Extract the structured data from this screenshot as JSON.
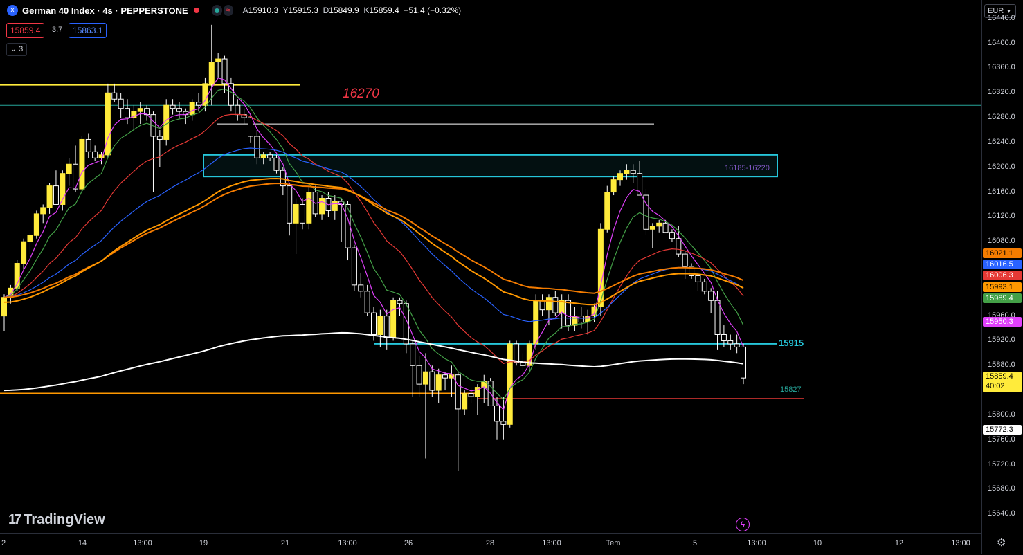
{
  "header": {
    "symbol_badge": "X",
    "title": "German 40 Index · 4s · PEPPERSTONE",
    "ohlc": [
      {
        "k": "A",
        "v": "15910.3"
      },
      {
        "k": "Y",
        "v": "15915.3"
      },
      {
        "k": "D",
        "v": "15849.9"
      },
      {
        "k": "K",
        "v": "15859.4"
      }
    ],
    "change": "−51.4 (−0.32%)",
    "sell_price": "15859.4",
    "spread": "3.7",
    "buy_price": "15863.1",
    "indicator_count": "3"
  },
  "currency": "EUR",
  "big_label": "16270",
  "zone_label": "16185-16220",
  "line_label_15915": "15915",
  "line_label_15827": "15827",
  "brand": "TradingView",
  "price_ticks": [
    "16440.0",
    "16400.0",
    "16360.0",
    "16320.0",
    "16280.0",
    "16240.0",
    "16200.0",
    "16160.0",
    "16120.0",
    "16080.0",
    "15960.0",
    "15920.0",
    "15880.0",
    "15800.0",
    "15760.0",
    "15720.0",
    "15680.0",
    "15640.0"
  ],
  "price_tags": [
    {
      "text": "16021.1",
      "bg": "#f57c00",
      "fg": "#000"
    },
    {
      "text": "16016.5",
      "bg": "#2962ff",
      "fg": "#fff"
    },
    {
      "text": "16006.3",
      "bg": "#e53935",
      "fg": "#fff"
    },
    {
      "text": "15993.1",
      "bg": "#ff9800",
      "fg": "#000"
    },
    {
      "text": "15989.4",
      "bg": "#43a047",
      "fg": "#fff"
    },
    {
      "text": "15950.3",
      "bg": "#e040fb",
      "fg": "#fff"
    },
    {
      "text": "15772.3",
      "bg": "#ffffff",
      "fg": "#000"
    }
  ],
  "current_price": {
    "price": "15859.4",
    "countdown": "40:02",
    "bg": "#ffeb3b"
  },
  "time_ticks": [
    "2",
    "14",
    "13:00",
    "19",
    "21",
    "13:00",
    "26",
    "28",
    "13:00",
    "Tem",
    "5",
    "13:00",
    "10",
    "12",
    "13:00"
  ],
  "chart_data": {
    "type": "candlestick",
    "symbol": "German 40 Index",
    "timeframe": "4s",
    "ylim": [
      15610,
      16470
    ],
    "candles": [
      [
        15960,
        15995,
        15935,
        15990
      ],
      [
        15990,
        16010,
        15980,
        16005
      ],
      [
        16005,
        16050,
        16000,
        16045
      ],
      [
        16045,
        16085,
        16035,
        16080
      ],
      [
        16080,
        16095,
        16060,
        16090
      ],
      [
        16090,
        16130,
        16085,
        16125
      ],
      [
        16125,
        16140,
        16110,
        16135
      ],
      [
        16135,
        16175,
        16125,
        16170
      ],
      [
        16170,
        16195,
        16150,
        16140
      ],
      [
        16140,
        16195,
        16130,
        16190
      ],
      [
        16190,
        16215,
        16170,
        16205
      ],
      [
        16205,
        16235,
        16160,
        16165
      ],
      [
        16165,
        16250,
        16160,
        16245
      ],
      [
        16245,
        16255,
        16215,
        16225
      ],
      [
        16225,
        16235,
        16210,
        16215
      ],
      [
        16215,
        16225,
        16205,
        16220
      ],
      [
        16220,
        16335,
        16215,
        16320
      ],
      [
        16320,
        16335,
        16305,
        16310
      ],
      [
        16310,
        16320,
        16280,
        16295
      ],
      [
        16295,
        16310,
        16270,
        16280
      ],
      [
        16280,
        16300,
        16260,
        16290
      ],
      [
        16290,
        16305,
        16270,
        16295
      ],
      [
        16295,
        16300,
        16275,
        16285
      ],
      [
        16285,
        16290,
        16160,
        16250
      ],
      [
        16250,
        16260,
        16200,
        16245
      ],
      [
        16245,
        16310,
        16235,
        16300
      ],
      [
        16300,
        16310,
        16285,
        16295
      ],
      [
        16295,
        16305,
        16280,
        16290
      ],
      [
        16290,
        16295,
        16270,
        16285
      ],
      [
        16285,
        16310,
        16275,
        16305
      ],
      [
        16305,
        16320,
        16290,
        16300
      ],
      [
        16300,
        16345,
        16290,
        16335
      ],
      [
        16335,
        16430,
        16300,
        16370
      ],
      [
        16370,
        16385,
        16345,
        16375
      ],
      [
        16375,
        16380,
        16320,
        16335
      ],
      [
        16335,
        16345,
        16290,
        16300
      ],
      [
        16300,
        16310,
        16275,
        16285
      ],
      [
        16285,
        16295,
        16270,
        16280
      ],
      [
        16280,
        16285,
        16240,
        16250
      ],
      [
        16250,
        16260,
        16205,
        16215
      ],
      [
        16215,
        16225,
        16205,
        16220
      ],
      [
        16220,
        16225,
        16210,
        16215
      ],
      [
        16215,
        16220,
        16190,
        16195
      ],
      [
        16195,
        16200,
        16155,
        16170
      ],
      [
        16170,
        16175,
        16090,
        16110
      ],
      [
        16110,
        16150,
        16060,
        16140
      ],
      [
        16140,
        16150,
        16100,
        16110
      ],
      [
        16110,
        16170,
        16100,
        16160
      ],
      [
        16160,
        16170,
        16120,
        16125
      ],
      [
        16125,
        16155,
        16115,
        16150
      ],
      [
        16150,
        16160,
        16120,
        16130
      ],
      [
        16130,
        16155,
        16115,
        16145
      ],
      [
        16145,
        16150,
        16080,
        16140
      ],
      [
        16140,
        16145,
        16050,
        16070
      ],
      [
        16070,
        16075,
        16000,
        16010
      ],
      [
        16010,
        16030,
        15990,
        16000
      ],
      [
        16000,
        16010,
        15960,
        15965
      ],
      [
        15965,
        15975,
        15920,
        15930
      ],
      [
        15930,
        15970,
        15910,
        15960
      ],
      [
        15960,
        15970,
        15905,
        15925
      ],
      [
        15925,
        15990,
        15920,
        15985
      ],
      [
        15985,
        15990,
        15960,
        15980
      ],
      [
        15980,
        15985,
        15900,
        15915
      ],
      [
        15915,
        15920,
        15830,
        15880
      ],
      [
        15880,
        15895,
        15830,
        15850
      ],
      [
        15850,
        15900,
        15730,
        15870
      ],
      [
        15870,
        15880,
        15830,
        15840
      ],
      [
        15840,
        15875,
        15820,
        15865
      ],
      [
        15865,
        15870,
        15840,
        15860
      ],
      [
        15860,
        15880,
        15830,
        15865
      ],
      [
        15865,
        15870,
        15710,
        15810
      ],
      [
        15810,
        15840,
        15800,
        15835
      ],
      [
        15835,
        15845,
        15820,
        15830
      ],
      [
        15830,
        15850,
        15800,
        15845
      ],
      [
        15845,
        15865,
        15820,
        15855
      ],
      [
        15855,
        15860,
        15820,
        15815
      ],
      [
        15815,
        15830,
        15760,
        15790
      ],
      [
        15790,
        15830,
        15760,
        15785
      ],
      [
        15785,
        15920,
        15780,
        15915
      ],
      [
        15915,
        15920,
        15880,
        15885
      ],
      [
        15885,
        15900,
        15870,
        15880
      ],
      [
        15880,
        15920,
        15870,
        15915
      ],
      [
        15915,
        15995,
        15905,
        15985
      ],
      [
        15985,
        15995,
        15960,
        15970
      ],
      [
        15970,
        15995,
        15945,
        15990
      ],
      [
        15990,
        16000,
        15960,
        15965
      ],
      [
        15965,
        15995,
        15940,
        15985
      ],
      [
        15985,
        15995,
        15935,
        15945
      ],
      [
        15945,
        15975,
        15935,
        15960
      ],
      [
        15960,
        15975,
        15940,
        15950
      ],
      [
        15950,
        15970,
        15930,
        15960
      ],
      [
        15960,
        15980,
        15950,
        15975
      ],
      [
        15975,
        16110,
        15960,
        16100
      ],
      [
        16100,
        16170,
        16095,
        16160
      ],
      [
        16160,
        16185,
        16155,
        16180
      ],
      [
        16180,
        16195,
        16170,
        16190
      ],
      [
        16190,
        16205,
        16180,
        16195
      ],
      [
        16195,
        16205,
        16175,
        16190
      ],
      [
        16190,
        16210,
        16175,
        16155
      ],
      [
        16155,
        16165,
        16090,
        16100
      ],
      [
        16100,
        16110,
        16070,
        16105
      ],
      [
        16105,
        16115,
        16095,
        16110
      ],
      [
        16110,
        16115,
        16095,
        16095
      ],
      [
        16095,
        16100,
        16080,
        16085
      ],
      [
        16085,
        16105,
        16055,
        16060
      ],
      [
        16060,
        16065,
        16020,
        16040
      ],
      [
        16040,
        16045,
        16020,
        16025
      ],
      [
        16025,
        16030,
        16000,
        16015
      ],
      [
        16015,
        16020,
        15995,
        16000
      ],
      [
        16000,
        16005,
        15965,
        15985
      ],
      [
        15985,
        16000,
        15905,
        15930
      ],
      [
        15930,
        15945,
        15910,
        15920
      ],
      [
        15920,
        15930,
        15905,
        15915
      ],
      [
        15915,
        15930,
        15900,
        15910
      ],
      [
        15910,
        15915,
        15850,
        15860
      ]
    ],
    "moving_averages": [
      {
        "color": "#e040fb",
        "last": "15950.3"
      },
      {
        "color": "#43a047",
        "last": "15989.4"
      },
      {
        "color": "#e53935",
        "last": "16006.3"
      },
      {
        "color": "#2962ff",
        "last": "16016.5"
      },
      {
        "color": "#f57c00",
        "last": "16021.1"
      },
      {
        "color": "#ff9800",
        "last": "15993.1"
      },
      {
        "color": "#ffffff",
        "last": "15772.3"
      }
    ],
    "horizontal_levels": [
      {
        "price": 16333,
        "color": "#ffeb3b"
      },
      {
        "price": 16300,
        "color": "#26a69a"
      },
      {
        "price": 16270,
        "color": "#ffffff"
      },
      {
        "price": 15915,
        "color": "#26c6da",
        "label": "15915"
      },
      {
        "price": 15835,
        "color": "#ff9800"
      },
      {
        "price": 15827,
        "color": "#e53935",
        "label": "15827"
      }
    ],
    "zone": {
      "low": 16185,
      "high": 16220,
      "label": "16185-16220",
      "color": "#26c6da"
    }
  }
}
